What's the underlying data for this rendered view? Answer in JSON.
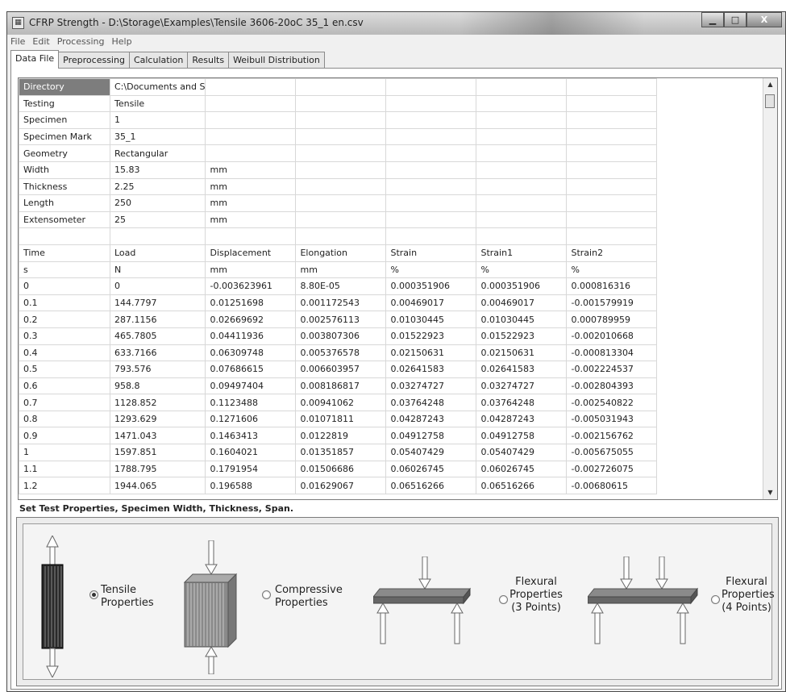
{
  "window": {
    "title": "CFRP Strength - D:\\Storage\\Examples\\Tensile 3606-20oC  35_1 en.csv",
    "min_glyph": "▁",
    "max_glyph": "□",
    "close_glyph": "X"
  },
  "menu": [
    "File",
    "Edit",
    "Processing",
    "Help"
  ],
  "tabs": [
    "Data File",
    "Preprocessing",
    "Calculation",
    "Results",
    "Weibull Distribution"
  ],
  "grid": {
    "rows": [
      [
        "Directory",
        "C:\\Documents and S",
        "",
        "",
        "",
        "",
        ""
      ],
      [
        "Testing",
        "Tensile",
        "",
        "",
        "",
        "",
        ""
      ],
      [
        "Specimen",
        "1",
        "",
        "",
        "",
        "",
        ""
      ],
      [
        "Specimen Mark",
        "35_1",
        "",
        "",
        "",
        "",
        ""
      ],
      [
        "Geometry",
        "Rectangular",
        "",
        "",
        "",
        "",
        ""
      ],
      [
        "Width",
        "15.83",
        "mm",
        "",
        "",
        "",
        ""
      ],
      [
        "Thickness",
        "2.25",
        "mm",
        "",
        "",
        "",
        ""
      ],
      [
        "Length",
        "250",
        "mm",
        "",
        "",
        "",
        ""
      ],
      [
        "Extensometer",
        "25",
        "mm",
        "",
        "",
        "",
        ""
      ],
      [
        "",
        "",
        "",
        "",
        "",
        "",
        ""
      ],
      [
        "Time",
        "Load",
        "Displacement",
        "Elongation",
        "Strain",
        "Strain1",
        "Strain2"
      ],
      [
        "s",
        "N",
        "mm",
        "mm",
        "%",
        "%",
        "%"
      ],
      [
        "0",
        "0",
        "-0.003623961",
        "8.80E-05",
        "0.000351906",
        "0.000351906",
        "0.000816316"
      ],
      [
        "0.1",
        "144.7797",
        "0.01251698",
        "0.001172543",
        "0.00469017",
        "0.00469017",
        "-0.001579919"
      ],
      [
        "0.2",
        "287.1156",
        "0.02669692",
        "0.002576113",
        "0.01030445",
        "0.01030445",
        "0.000789959"
      ],
      [
        "0.3",
        "465.7805",
        "0.04411936",
        "0.003807306",
        "0.01522923",
        "0.01522923",
        "-0.002010668"
      ],
      [
        "0.4",
        "633.7166",
        "0.06309748",
        "0.005376578",
        "0.02150631",
        "0.02150631",
        "-0.000813304"
      ],
      [
        "0.5",
        "793.576",
        "0.07686615",
        "0.006603957",
        "0.02641583",
        "0.02641583",
        "-0.002224537"
      ],
      [
        "0.6",
        "958.8",
        "0.09497404",
        "0.008186817",
        "0.03274727",
        "0.03274727",
        "-0.002804393"
      ],
      [
        "0.7",
        "1128.852",
        "0.1123488",
        "0.00941062",
        "0.03764248",
        "0.03764248",
        "-0.002540822"
      ],
      [
        "0.8",
        "1293.629",
        "0.1271606",
        "0.01071811",
        "0.04287243",
        "0.04287243",
        "-0.005031943"
      ],
      [
        "0.9",
        "1471.043",
        "0.1463413",
        "0.0122819",
        "0.04912758",
        "0.04912758",
        "-0.002156762"
      ],
      [
        "1",
        "1597.851",
        "0.1604021",
        "0.01351857",
        "0.05407429",
        "0.05407429",
        "-0.005675055"
      ],
      [
        "1.1",
        "1788.795",
        "0.1791954",
        "0.01506686",
        "0.06026745",
        "0.06026745",
        "-0.002726075"
      ],
      [
        "1.2",
        "1944.065",
        "0.196588",
        "0.01629067",
        "0.06516266",
        "0.06516266",
        "-0.00680615"
      ]
    ]
  },
  "hint": "Set Test Properties, Specimen Width, Thickness, Span.",
  "options": {
    "tensile": {
      "line1": "Tensile",
      "line2": "Properties",
      "line3": "",
      "checked": true
    },
    "compressive": {
      "line1": "Compressive",
      "line2": "Properties",
      "line3": "",
      "checked": false
    },
    "flexural3": {
      "line1": "Flexural",
      "line2": "Properties",
      "line3": "(3 Points)",
      "checked": false
    },
    "flexural4": {
      "line1": "Flexural",
      "line2": "Properties",
      "line3": "(4 Points)",
      "checked": false
    }
  }
}
